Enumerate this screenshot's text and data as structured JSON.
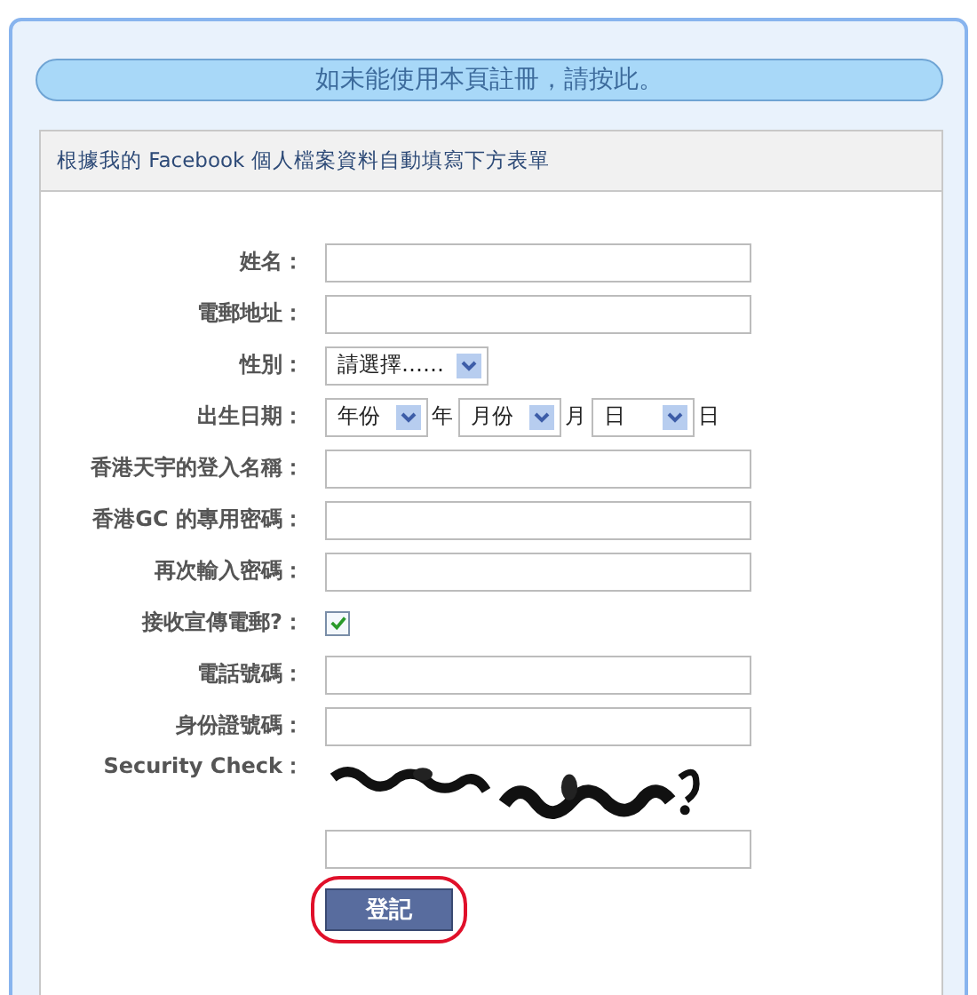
{
  "banner": {
    "text": "如未能使用本頁註冊，請按此。"
  },
  "header": {
    "text": "根據我的 Facebook 個人檔案資料自動填寫下方表單"
  },
  "fields": [
    {
      "kind": "text",
      "label": "姓名："
    },
    {
      "kind": "text",
      "label": "電郵地址："
    },
    {
      "kind": "select",
      "label": "性別：",
      "value": "請選擇……"
    },
    {
      "kind": "date",
      "label": "出生日期：",
      "parts": [
        {
          "value": "年份",
          "suffix": "年"
        },
        {
          "value": "月份",
          "suffix": "月"
        },
        {
          "value": "日",
          "suffix": "日"
        }
      ]
    },
    {
      "kind": "text",
      "label": "香港天宇的登入名稱："
    },
    {
      "kind": "text",
      "label": "香港GC 的專用密碼："
    },
    {
      "kind": "text",
      "label": "再次輸入密碼："
    },
    {
      "kind": "checkbox",
      "label": "接收宣傳電郵?：",
      "checked": true
    },
    {
      "kind": "text",
      "label": "電話號碼："
    },
    {
      "kind": "text",
      "label": "身份證號碼："
    },
    {
      "kind": "captcha",
      "label": "Security Check："
    }
  ],
  "submit": {
    "label": "登記",
    "highlighted": true
  }
}
